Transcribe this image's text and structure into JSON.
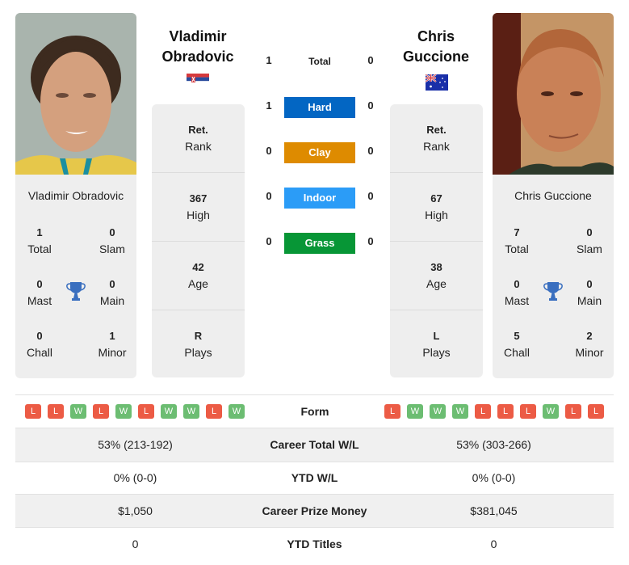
{
  "players": [
    {
      "name": "Vladimir Obradovic",
      "first_name": "Vladimir",
      "last_name": "Obradovic",
      "flag": "serbia-flag",
      "titles": {
        "total": {
          "value": "1",
          "label": "Total"
        },
        "slam": {
          "value": "0",
          "label": "Slam"
        },
        "mast": {
          "value": "0",
          "label": "Mast"
        },
        "main": {
          "value": "0",
          "label": "Main"
        },
        "chall": {
          "value": "0",
          "label": "Chall"
        },
        "minor": {
          "value": "1",
          "label": "Minor"
        }
      },
      "info": [
        {
          "value": "Ret.",
          "label": "Rank"
        },
        {
          "value": "367",
          "label": "High"
        },
        {
          "value": "42",
          "label": "Age"
        },
        {
          "value": "R",
          "label": "Plays"
        }
      ],
      "form": [
        "L",
        "L",
        "W",
        "L",
        "W",
        "L",
        "W",
        "W",
        "L",
        "W"
      ]
    },
    {
      "name": "Chris Guccione",
      "first_name": "Chris",
      "last_name": "Guccione",
      "flag": "australia-flag",
      "titles": {
        "total": {
          "value": "7",
          "label": "Total"
        },
        "slam": {
          "value": "0",
          "label": "Slam"
        },
        "mast": {
          "value": "0",
          "label": "Mast"
        },
        "main": {
          "value": "0",
          "label": "Main"
        },
        "chall": {
          "value": "5",
          "label": "Chall"
        },
        "minor": {
          "value": "2",
          "label": "Minor"
        }
      },
      "info": [
        {
          "value": "Ret.",
          "label": "Rank"
        },
        {
          "value": "67",
          "label": "High"
        },
        {
          "value": "38",
          "label": "Age"
        },
        {
          "value": "L",
          "label": "Plays"
        }
      ],
      "form": [
        "L",
        "W",
        "W",
        "W",
        "L",
        "L",
        "L",
        "W",
        "L",
        "L"
      ]
    }
  ],
  "h2h": {
    "total": {
      "label": "Total",
      "left": "1",
      "right": "0"
    },
    "surfaces": [
      {
        "label": "Hard",
        "left": "1",
        "right": "0",
        "color": "#0366c3"
      },
      {
        "label": "Clay",
        "left": "0",
        "right": "0",
        "color": "#de8b00"
      },
      {
        "label": "Indoor",
        "left": "0",
        "right": "0",
        "color": "#2b9cf7"
      },
      {
        "label": "Grass",
        "left": "0",
        "right": "0",
        "color": "#079636"
      }
    ]
  },
  "form_label": "Form",
  "comparison": [
    {
      "label": "Career Total W/L",
      "left": "53% (213-192)",
      "right": "53% (303-266)"
    },
    {
      "label": "YTD W/L",
      "left": "0% (0-0)",
      "right": "0% (0-0)"
    },
    {
      "label": "Career Prize Money",
      "left": "$1,050",
      "right": "$381,045"
    },
    {
      "label": "YTD Titles",
      "left": "0",
      "right": "0"
    }
  ],
  "colors": {
    "loss": "#ec5b45",
    "win": "#6cbd72",
    "trophy": "#3a6fbf"
  }
}
